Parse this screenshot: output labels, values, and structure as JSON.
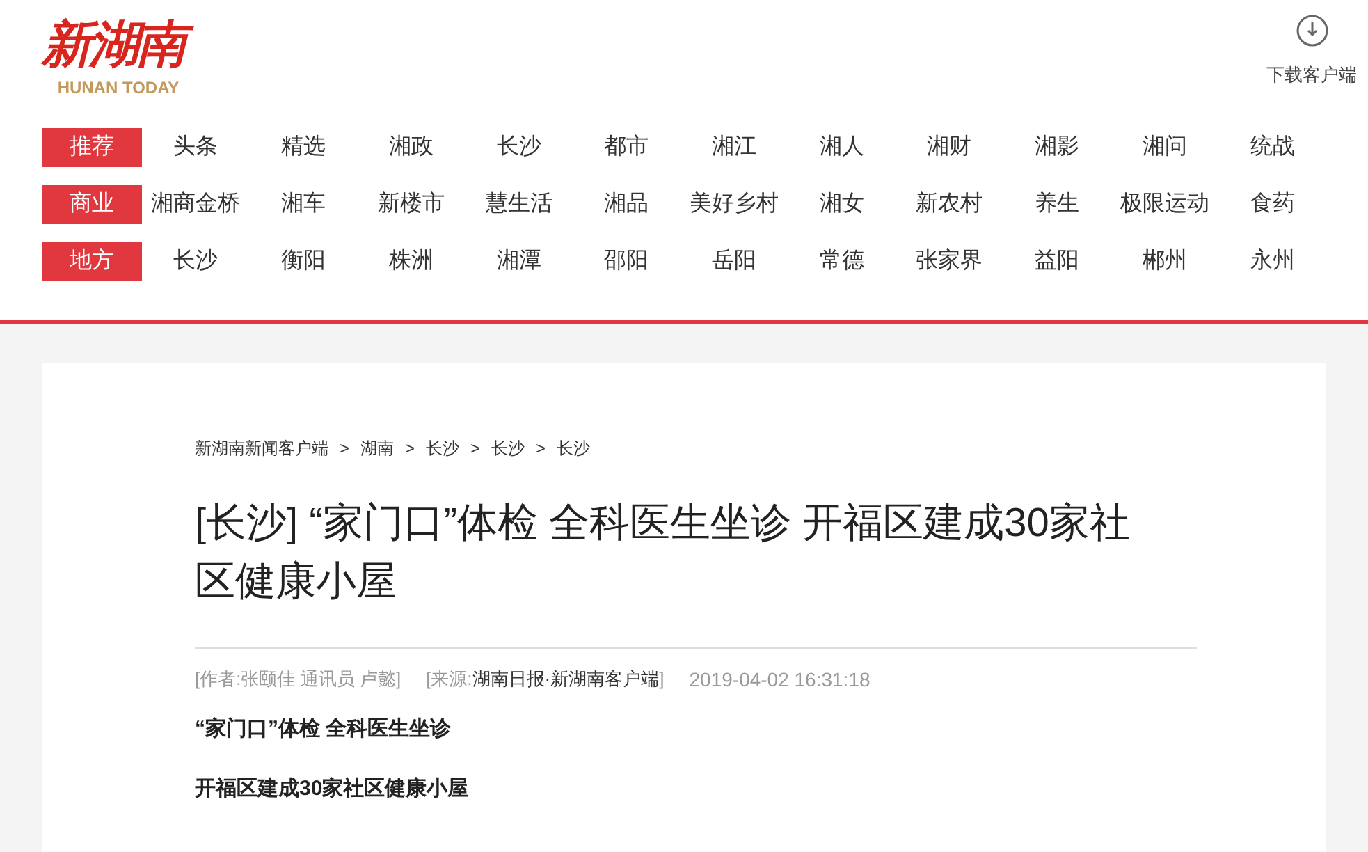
{
  "logo": {
    "name": "新湖南",
    "tagline": "HUNAN TODAY"
  },
  "download": {
    "label": "下载客户端"
  },
  "nav": [
    {
      "label": "推荐",
      "items": [
        "头条",
        "精选",
        "湘政",
        "长沙",
        "都市",
        "湘江",
        "湘人",
        "湘财",
        "湘影",
        "湘问",
        "统战"
      ]
    },
    {
      "label": "商业",
      "items": [
        "湘商金桥",
        "湘车",
        "新楼市",
        "慧生活",
        "湘品",
        "美好乡村",
        "湘女",
        "新农村",
        "养生",
        "极限运动",
        "食药"
      ]
    },
    {
      "label": "地方",
      "items": [
        "长沙",
        "衡阳",
        "株洲",
        "湘潭",
        "邵阳",
        "岳阳",
        "常德",
        "张家界",
        "益阳",
        "郴州",
        "永州"
      ]
    }
  ],
  "breadcrumb": [
    "新湖南新闻客户端",
    "湖南",
    "长沙",
    "长沙",
    "长沙"
  ],
  "breadcrumb_separator": ">",
  "article": {
    "title": "[长沙] “家门口”体检 全科医生坐诊 开福区建成30家社区健康小屋",
    "author": "[作者:张颐佳 通讯员 卢懿]",
    "source": {
      "prefix": "[来源:",
      "name": "湖南日报·新湖南客户端",
      "suffix": "]"
    },
    "time": "2019-04-02 16:31:18",
    "paragraphs": [
      "“家门口”体检 全科医生坐诊",
      "开福区建成30家社区健康小屋"
    ]
  }
}
